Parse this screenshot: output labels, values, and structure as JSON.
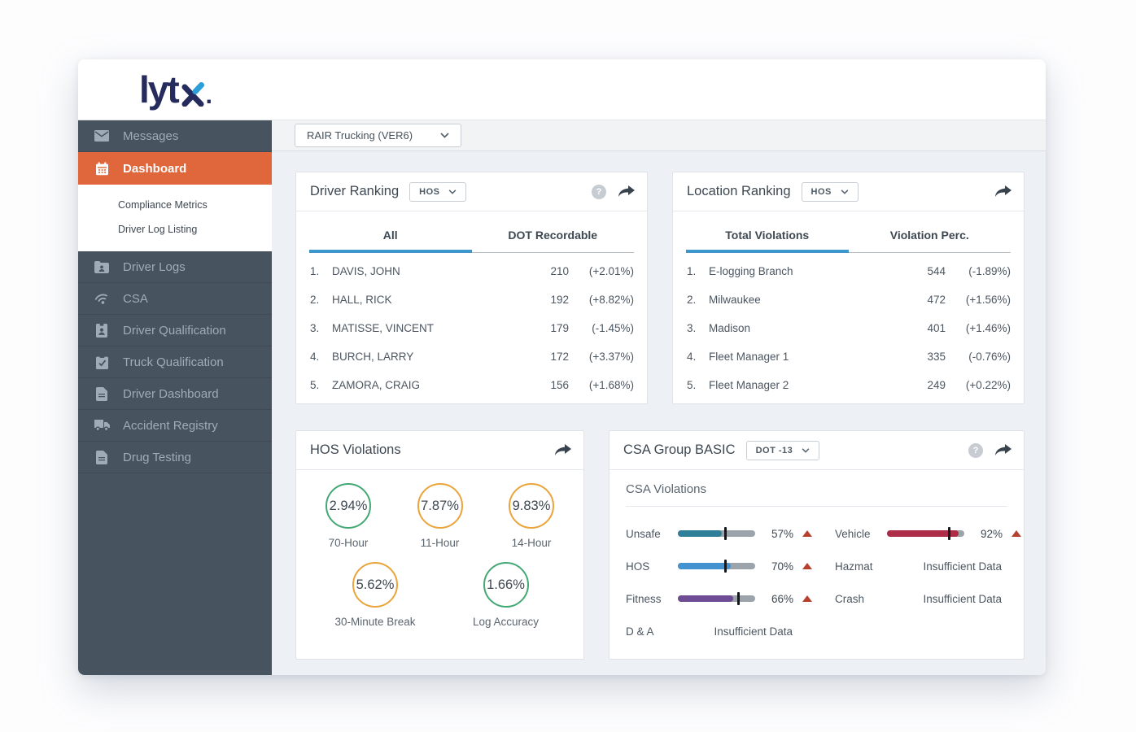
{
  "app": {
    "logo_text": "lyt",
    "logo_dot": ".",
    "colors": {
      "logo_navy": "#252B5C",
      "logo_teal": "#2D9FD8",
      "sidebar_bg": "#47535E",
      "active_orange": "#E0663C",
      "accent_blue": "#3D97CF",
      "content_bg": "#EDF1F6",
      "green": "#43A874",
      "amber": "#E9A43B",
      "trend_red": "#B5402E"
    }
  },
  "toolbar": {
    "account_selector": "RAIR Trucking (VER6)",
    "chevron_icon": "chevron-down-icon"
  },
  "sidebar": {
    "items": [
      {
        "label": "Messages",
        "icon": "envelope-icon",
        "active": false
      },
      {
        "label": "Dashboard",
        "icon": "calendar-icon",
        "active": true
      },
      {
        "label": "Driver Logs",
        "icon": "folder-user-icon",
        "active": false
      },
      {
        "label": "CSA",
        "icon": "signal-icon",
        "active": false
      },
      {
        "label": "Driver Qualification",
        "icon": "id-badge-icon",
        "active": false
      },
      {
        "label": "Truck Qualification",
        "icon": "clipboard-check-icon",
        "active": false
      },
      {
        "label": "Driver Dashboard",
        "icon": "document-icon",
        "active": false
      },
      {
        "label": "Accident Registry",
        "icon": "truck-icon",
        "active": false
      },
      {
        "label": "Drug Testing",
        "icon": "document-icon",
        "active": false
      }
    ],
    "sub_items": [
      {
        "label": "Compliance Metrics"
      },
      {
        "label": "Driver Log Listing"
      }
    ]
  },
  "cards": {
    "driver_ranking": {
      "title": "Driver Ranking",
      "filter_value": "HOS",
      "help_icon": "question-icon",
      "share_icon": "share-forward-icon",
      "tabs": [
        {
          "label": "All",
          "active": true
        },
        {
          "label": "DOT Recordable",
          "active": false
        }
      ],
      "rows": [
        {
          "rank": "1.",
          "name": "DAVIS, JOHN",
          "value": "210",
          "delta": "(+2.01%)"
        },
        {
          "rank": "2.",
          "name": "HALL, RICK",
          "value": "192",
          "delta": "(+8.82%)"
        },
        {
          "rank": "3.",
          "name": "MATISSE, VINCENT",
          "value": "179",
          "delta": "(-1.45%)"
        },
        {
          "rank": "4.",
          "name": "BURCH, LARRY",
          "value": "172",
          "delta": "(+3.37%)"
        },
        {
          "rank": "5.",
          "name": "ZAMORA, CRAIG",
          "value": "156",
          "delta": "(+1.68%)"
        }
      ]
    },
    "location_ranking": {
      "title": "Location Ranking",
      "filter_value": "HOS",
      "share_icon": "share-forward-icon",
      "tabs": [
        {
          "label": "Total Violations",
          "active": true
        },
        {
          "label": "Violation Perc.",
          "active": false
        }
      ],
      "rows": [
        {
          "rank": "1.",
          "name": "E-logging Branch",
          "value": "544",
          "delta": "(-1.89%)"
        },
        {
          "rank": "2.",
          "name": "Milwaukee",
          "value": "472",
          "delta": "(+1.56%)"
        },
        {
          "rank": "3.",
          "name": "Madison",
          "value": "401",
          "delta": "(+1.46%)"
        },
        {
          "rank": "4.",
          "name": "Fleet Manager 1",
          "value": "335",
          "delta": "(-0.76%)"
        },
        {
          "rank": "5.",
          "name": "Fleet Manager 2",
          "value": "249",
          "delta": "(+0.22%)"
        }
      ]
    },
    "hos_violations": {
      "title": "HOS Violations",
      "share_icon": "share-forward-icon",
      "metrics": [
        {
          "value": "2.94%",
          "label": "70-Hour",
          "color": "#43A874"
        },
        {
          "value": "7.87%",
          "label": "11-Hour",
          "color": "#E9A43B"
        },
        {
          "value": "9.83%",
          "label": "14-Hour",
          "color": "#E9A43B"
        },
        {
          "value": "5.62%",
          "label": "30-Minute Break",
          "color": "#E9A43B"
        },
        {
          "value": "1.66%",
          "label": "Log Accuracy",
          "color": "#43A874"
        }
      ]
    },
    "csa_group": {
      "title": "CSA Group BASIC",
      "filter_value": "DOT -13",
      "help_icon": "question-icon",
      "share_icon": "share-forward-icon",
      "subtitle": "CSA Violations",
      "insufficient_text": "Insufficient Data",
      "left": [
        {
          "label": "Unsafe",
          "value": "57%",
          "trend": "up",
          "bar": {
            "color": "#2F7F99",
            "fill_pct": 57,
            "marker_pct": 61
          }
        },
        {
          "label": "HOS",
          "value": "70%",
          "trend": "up",
          "bar": {
            "color": "#4293CF",
            "fill_pct": 68,
            "marker_pct": 61
          }
        },
        {
          "label": "Fitness",
          "value": "66%",
          "trend": "up",
          "bar": {
            "color": "#6E4D94",
            "fill_pct": 72,
            "marker_pct": 78
          }
        },
        {
          "label": "D & A",
          "value": "Insufficient Data"
        }
      ],
      "right": [
        {
          "label": "Vehicle",
          "value": "92%",
          "trend": "up",
          "bar": {
            "color": "#AD2C47",
            "fill_pct": 93,
            "marker_pct": 80
          }
        },
        {
          "label": "Hazmat",
          "value": "Insufficient Data"
        },
        {
          "label": "Crash",
          "value": "Insufficient Data"
        }
      ]
    }
  }
}
